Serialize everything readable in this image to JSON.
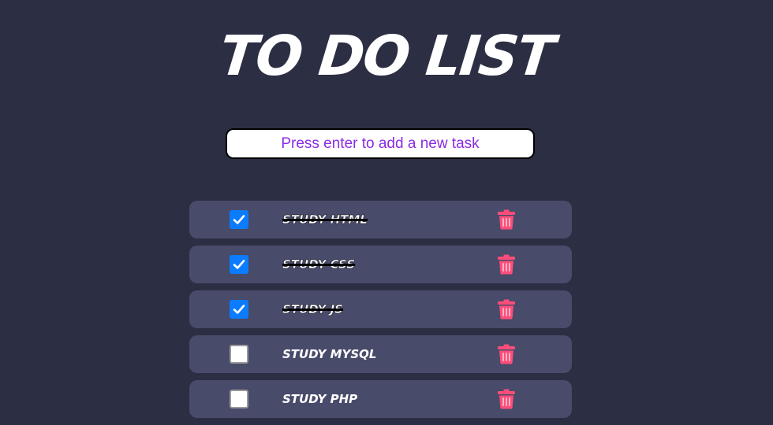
{
  "page": {
    "title": "TO DO LIST"
  },
  "input": {
    "placeholder": "Press enter to add a new task",
    "value": ""
  },
  "colors": {
    "background": "#2c2e43",
    "row": "#484b6a",
    "checkbox_checked": "#0b7cff",
    "trash_icon": "#ff4d7a",
    "placeholder_text": "#8a2be2"
  },
  "tasks": [
    {
      "label": "STUDY HTML",
      "done": true,
      "icon": "trash-icon"
    },
    {
      "label": "STUDY CSS",
      "done": true,
      "icon": "trash-icon"
    },
    {
      "label": "STUDY JS",
      "done": true,
      "icon": "trash-icon"
    },
    {
      "label": "STUDY MYSQL",
      "done": false,
      "icon": "trash-icon"
    },
    {
      "label": "STUDY PHP",
      "done": false,
      "icon": "trash-icon"
    }
  ]
}
